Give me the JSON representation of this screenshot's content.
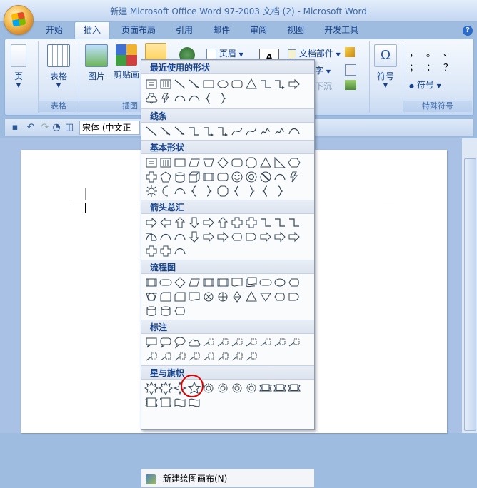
{
  "window": {
    "title": "新建 Microsoft Office Word 97-2003 文档 (2) - Microsoft Word"
  },
  "tabs": [
    "开始",
    "插入",
    "页面布局",
    "引用",
    "邮件",
    "审阅",
    "视图",
    "开发工具"
  ],
  "ribbon": {
    "page_label": "页",
    "table_label": "表格",
    "table_group": "表格",
    "picture_label": "图片",
    "clipart_label": "剪贴画",
    "illustration_group": "插图",
    "header_label": "页眉",
    "docparts_label": "文档部件",
    "wordart_label": "字",
    "dropcap_label": "下沉",
    "symbol_label": "符号",
    "special_symbol_label": "符号",
    "special_group": "特殊符号",
    "symbol_glyph": "Ω",
    "punct_1": "，",
    "punct_2": "。",
    "punct_3": "、",
    "punct_4": "；",
    "punct_5": "：",
    "punct_6": "？",
    "dot": "●"
  },
  "qat": {
    "font_name": "宋体 (中文正文"
  },
  "shapes_menu": {
    "sections": [
      "最近使用的形状",
      "线条",
      "基本形状",
      "箭头总汇",
      "流程图",
      "标注",
      "星与旗帜"
    ],
    "new_canvas": "新建绘图画布(N)"
  },
  "colors": {
    "accent": "#15428b",
    "highlight": "#e00000"
  }
}
